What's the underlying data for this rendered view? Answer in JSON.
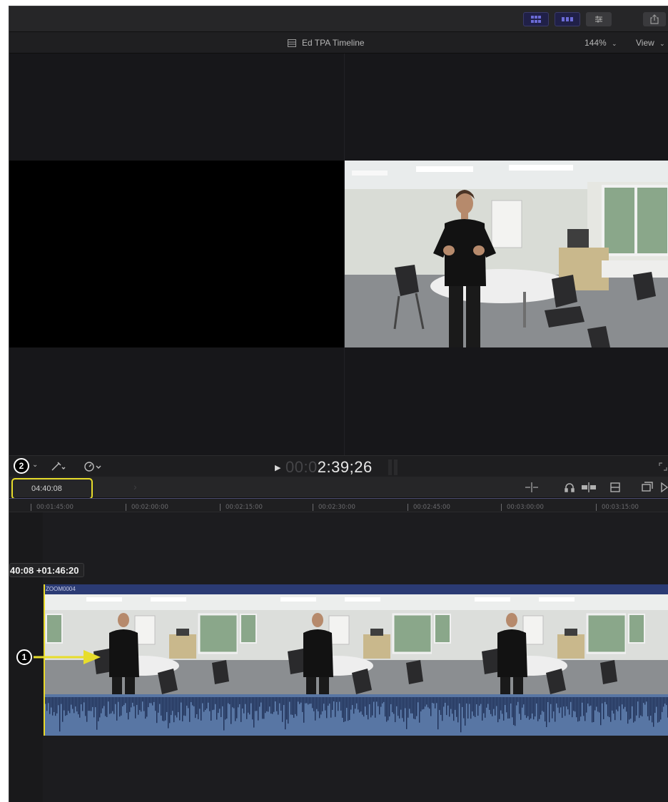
{
  "toolbar": {
    "buttons": [
      {
        "icon": "grid-view-icon",
        "active": true
      },
      {
        "icon": "filmstrip-view-icon",
        "active": true
      },
      {
        "icon": "inspector-sliders-icon",
        "active": false
      },
      {
        "icon": "share-icon",
        "active": false
      }
    ]
  },
  "viewer": {
    "title": "Ed TPA Timeline",
    "zoom": "144%",
    "view_menu": "View"
  },
  "transport": {
    "timecode_dim": "00:0",
    "timecode_bright": "2:39;26"
  },
  "timeline": {
    "duration": "04:40:08",
    "ruler_labels": [
      "00:01:45:00",
      "00:02:00:00",
      "00:02:15:00",
      "00:02:30:00",
      "00:02:45:00",
      "00:03:00:00",
      "00:03:15:00"
    ],
    "skim_tooltip": "40:08 +01:46:20",
    "clip_name": "ZOOM0004"
  },
  "annotations": {
    "marker1": "1",
    "marker2": "2"
  },
  "colors": {
    "highlight": "#e7dd2b",
    "clip_label": "#2b3b74",
    "audio": "#5876a4"
  }
}
